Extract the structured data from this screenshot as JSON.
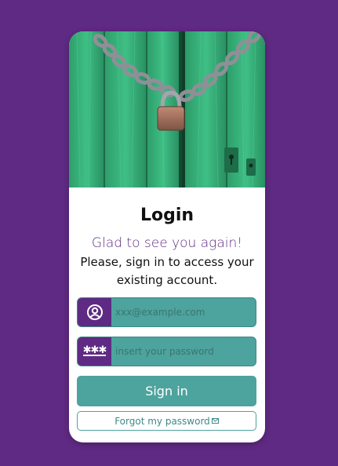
{
  "colors": {
    "background": "#5f2a83",
    "accent": "#4da39d",
    "card": "#ffffff"
  },
  "hero": {
    "image_icon": "padlock-chain-door-photo"
  },
  "login": {
    "title": "Login",
    "subtitle": "Glad to see you again!",
    "description": "Please, sign in to access your existing account."
  },
  "form": {
    "email": {
      "icon": "user-circle-icon",
      "placeholder": "xxx@example.com",
      "value": ""
    },
    "password": {
      "icon": "password-icon",
      "placeholder": "insert your password",
      "value": ""
    },
    "signin_label": "Sign in",
    "forgot_label": "Forgot my password",
    "forgot_icon": "envelope-icon"
  }
}
